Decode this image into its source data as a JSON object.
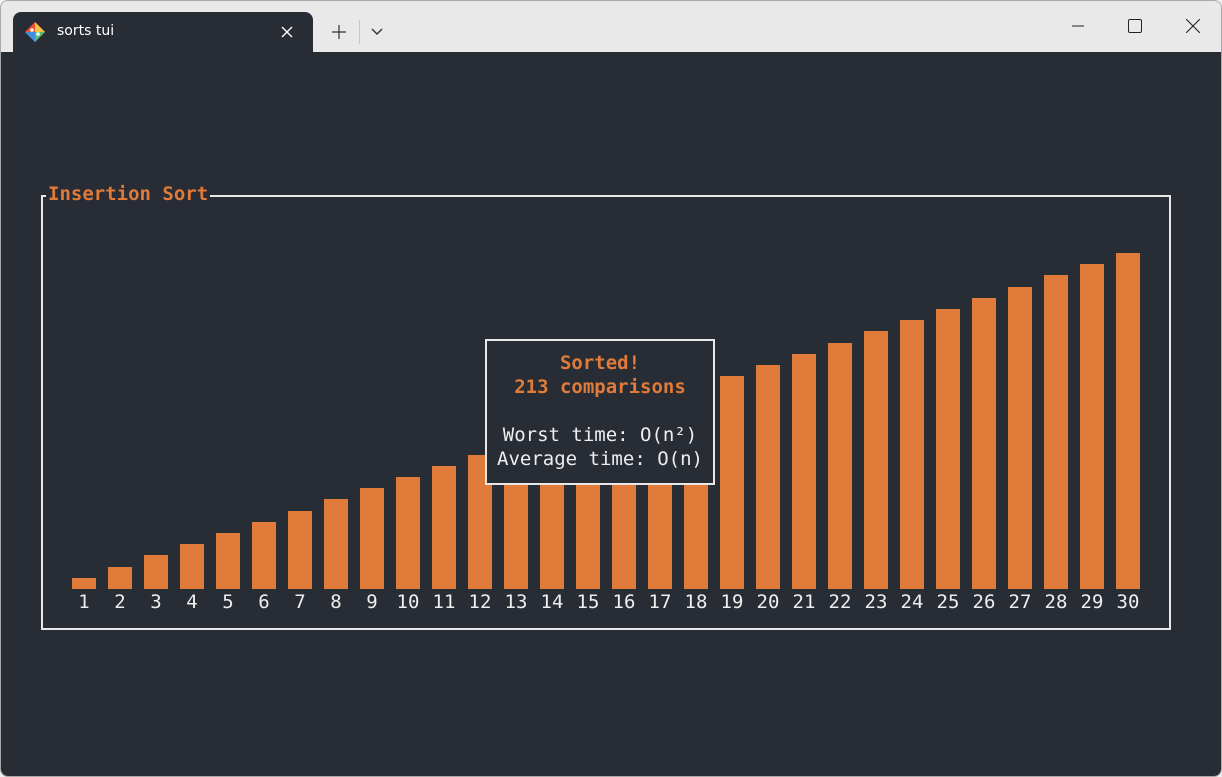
{
  "window": {
    "tab_title": "sorts tui",
    "tab_icon": "git-bash-diamond-icon"
  },
  "colors": {
    "terminal_bg": "#282c34",
    "accent": "#e07b39",
    "text": "#eeeeee",
    "border": "#e8e8e8"
  },
  "panel": {
    "title": "Insertion Sort"
  },
  "dialog": {
    "status": "Sorted!",
    "comparisons": "213 comparisons",
    "worst_time": "Worst time: O(n²)",
    "average_time": "Average time: O(n)"
  },
  "chart_data": {
    "type": "bar",
    "categories": [
      "1",
      "2",
      "3",
      "4",
      "5",
      "6",
      "7",
      "8",
      "9",
      "10",
      "11",
      "12",
      "13",
      "14",
      "15",
      "16",
      "17",
      "18",
      "19",
      "20",
      "21",
      "22",
      "23",
      "24",
      "25",
      "26",
      "27",
      "28",
      "29",
      "30"
    ],
    "values": [
      1,
      2,
      3,
      4,
      5,
      6,
      7,
      8,
      9,
      10,
      11,
      12,
      13,
      14,
      15,
      16,
      17,
      18,
      19,
      20,
      21,
      22,
      23,
      24,
      25,
      26,
      27,
      28,
      29,
      30
    ],
    "title": "Insertion Sort",
    "xlabel": "",
    "ylabel": "",
    "grid": false
  }
}
